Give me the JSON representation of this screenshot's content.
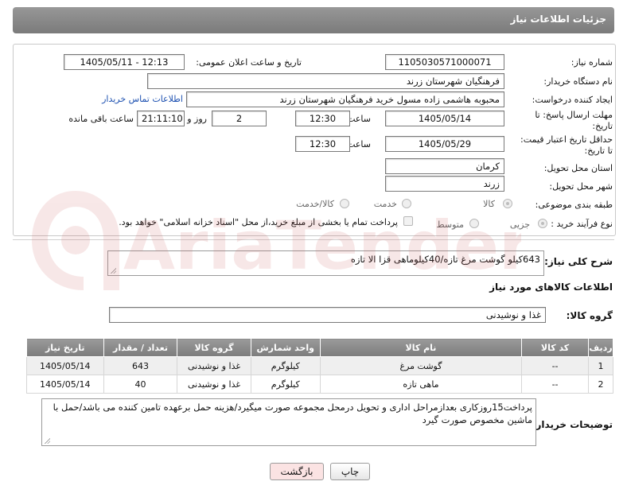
{
  "header": {
    "title": "جزئیات اطلاعات نیاز"
  },
  "form": {
    "need_number_label": "شماره نیاز:",
    "need_number": "1105030571000071",
    "announce_label": "تاریخ و ساعت اعلان عمومی:",
    "announce_value": "1405/05/11 - 12:13",
    "buyer_org_label": "نام دستگاه خریدار:",
    "buyer_org": "فرهنگیان شهرستان زرند",
    "requester_label": "ایجاد کننده درخواست:",
    "requester": "محبوبه هاشمی زاده مسول خرید فرهنگیان شهرستان زرند",
    "buyer_contact_link": "اطلاعات تماس خریدار",
    "deadline_label_1": "مهلت ارسال پاسخ: تا",
    "deadline_label_2": "تاریخ:",
    "deadline_date": "1405/05/14",
    "time_label": "ساعت",
    "deadline_time": "12:30",
    "days_value": "2",
    "days_label": "روز و",
    "remaining_time": "21:11:10",
    "remaining_label": "ساعت باقی مانده",
    "min_validity_label_1": "حداقل تاریخ اعتبار قیمت:",
    "min_validity_label_2": "تا تاریخ:",
    "validity_date": "1405/05/29",
    "validity_time_label": "ساعت",
    "validity_time": "12:30",
    "province_label": "استان محل تحویل:",
    "province": "کرمان",
    "city_label": "شهر محل تحویل:",
    "city": "زرند",
    "category_label": "طبقه بندی موضوعی:",
    "category_options": [
      "کالا",
      "خدمت",
      "کالا/خدمت"
    ],
    "category_selected": "کالا",
    "process_label": "نوع فرآیند خرید :",
    "process_options": [
      "جزیی",
      "متوسط"
    ],
    "process_selected": "جزیی",
    "payment_note": "پرداخت تمام یا بخشی از مبلغ خرید،از محل \"اسناد خزانه اسلامی\" خواهد بود."
  },
  "description": {
    "label": "شرح کلی نیاز:",
    "text": "643کیلو گوشت مرغ تازه/40کیلوماهی قزا الا تازه"
  },
  "goods_info": {
    "title": "اطلاعات کالاهای مورد نیاز",
    "group_label": "گروه کالا:",
    "group_value": "غذا و نوشیدنی"
  },
  "table": {
    "columns": [
      "ردیف",
      "کد کالا",
      "نام کالا",
      "واحد شمارش",
      "گروه کالا",
      "تعداد / مقدار",
      "تاریخ نیاز"
    ],
    "rows": [
      {
        "row": "1",
        "code": "--",
        "name": "گوشت مرغ",
        "unit": "کیلوگرم",
        "group": "غذا و نوشیدنی",
        "qty": "643",
        "date": "1405/05/14"
      },
      {
        "row": "2",
        "code": "--",
        "name": "ماهی تازه",
        "unit": "کیلوگرم",
        "group": "غذا و نوشیدنی",
        "qty": "40",
        "date": "1405/05/14"
      }
    ]
  },
  "buyer_notes": {
    "label": "توضیحات خریدار:",
    "text": "پرداخت15روزکاری بعدازمراحل اداری و تحویل درمحل مجموعه صورت میگیرد/هزینه حمل برعهده تامین کننده می باشد/حمل با ماشین مخصوص صورت گیرد"
  },
  "buttons": {
    "print": "چاپ",
    "back": "بازگشت"
  },
  "watermark_text": "AriaTender.neT",
  "colors": {
    "header_bg": "#8a8a8a",
    "link": "#1b4fb0",
    "watermark": "#c94f4f",
    "back_button": "#fbe3e3"
  }
}
